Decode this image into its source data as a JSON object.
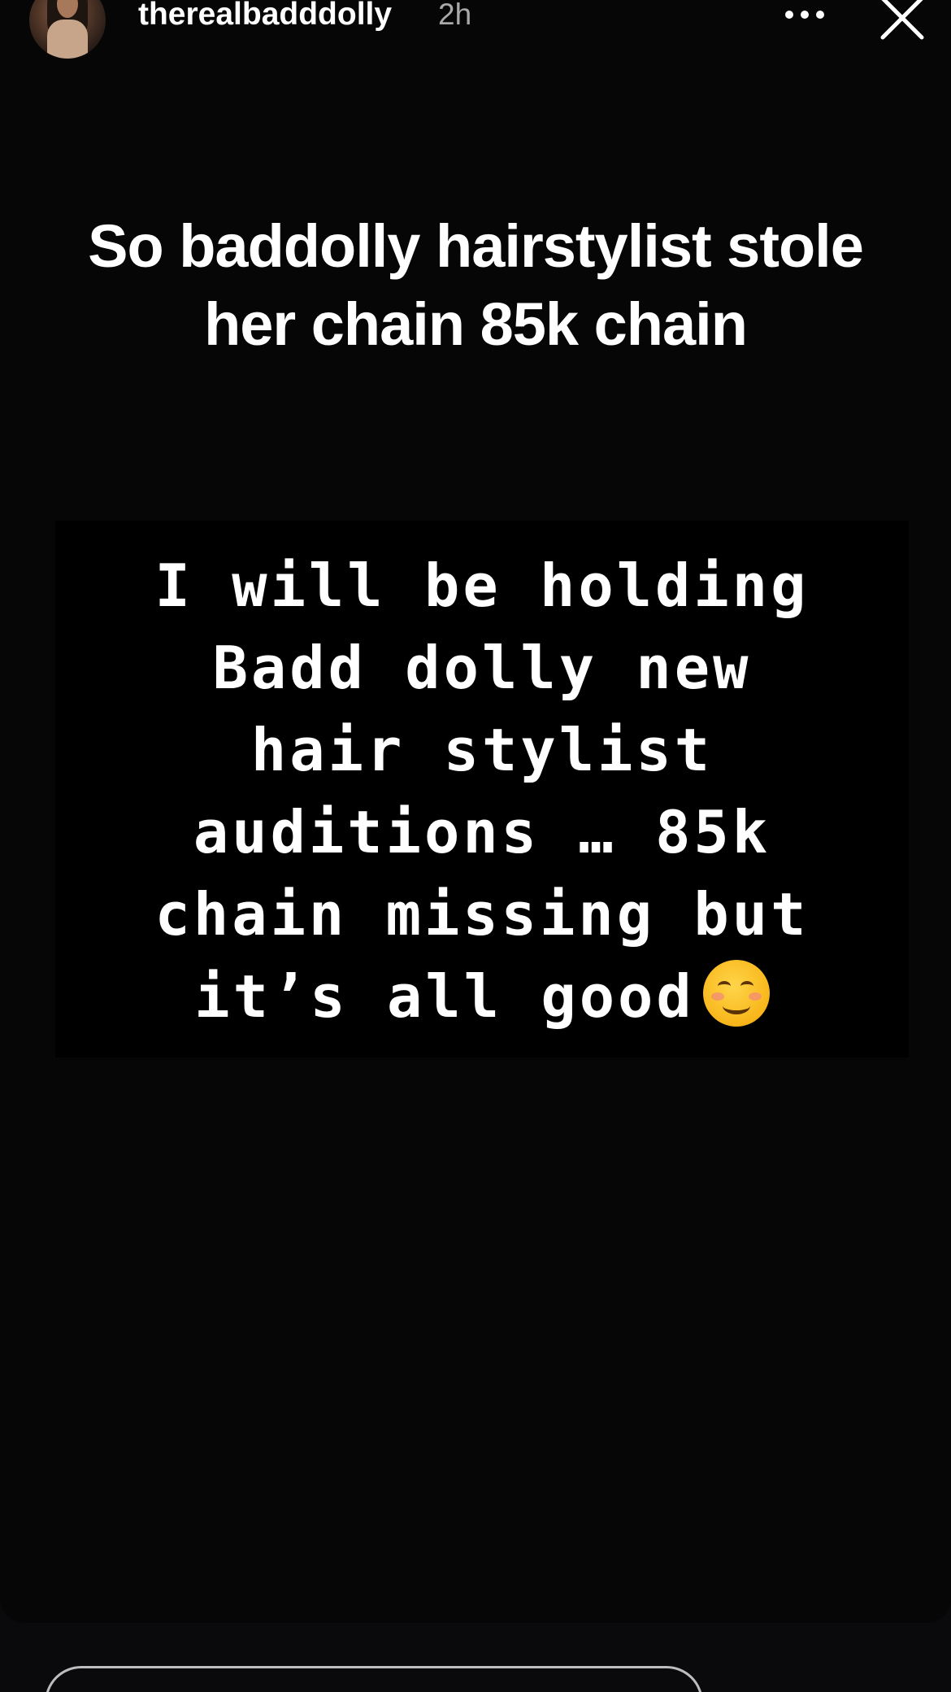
{
  "header": {
    "username": "therealbadddolly",
    "time": "2h",
    "more_icon": "ellipsis-icon",
    "close_icon": "close-icon"
  },
  "story": {
    "caption": "So baddolly hairstylist stole her chain 85k chain",
    "pixel_text": "I will be holding\nBadd dolly new\nhair stylist\nauditions … 85k\nchain missing but\nit’s all good",
    "emoji": "smiling-face-with-smiling-eyes"
  },
  "footer": {
    "reply_placeholder": ""
  }
}
